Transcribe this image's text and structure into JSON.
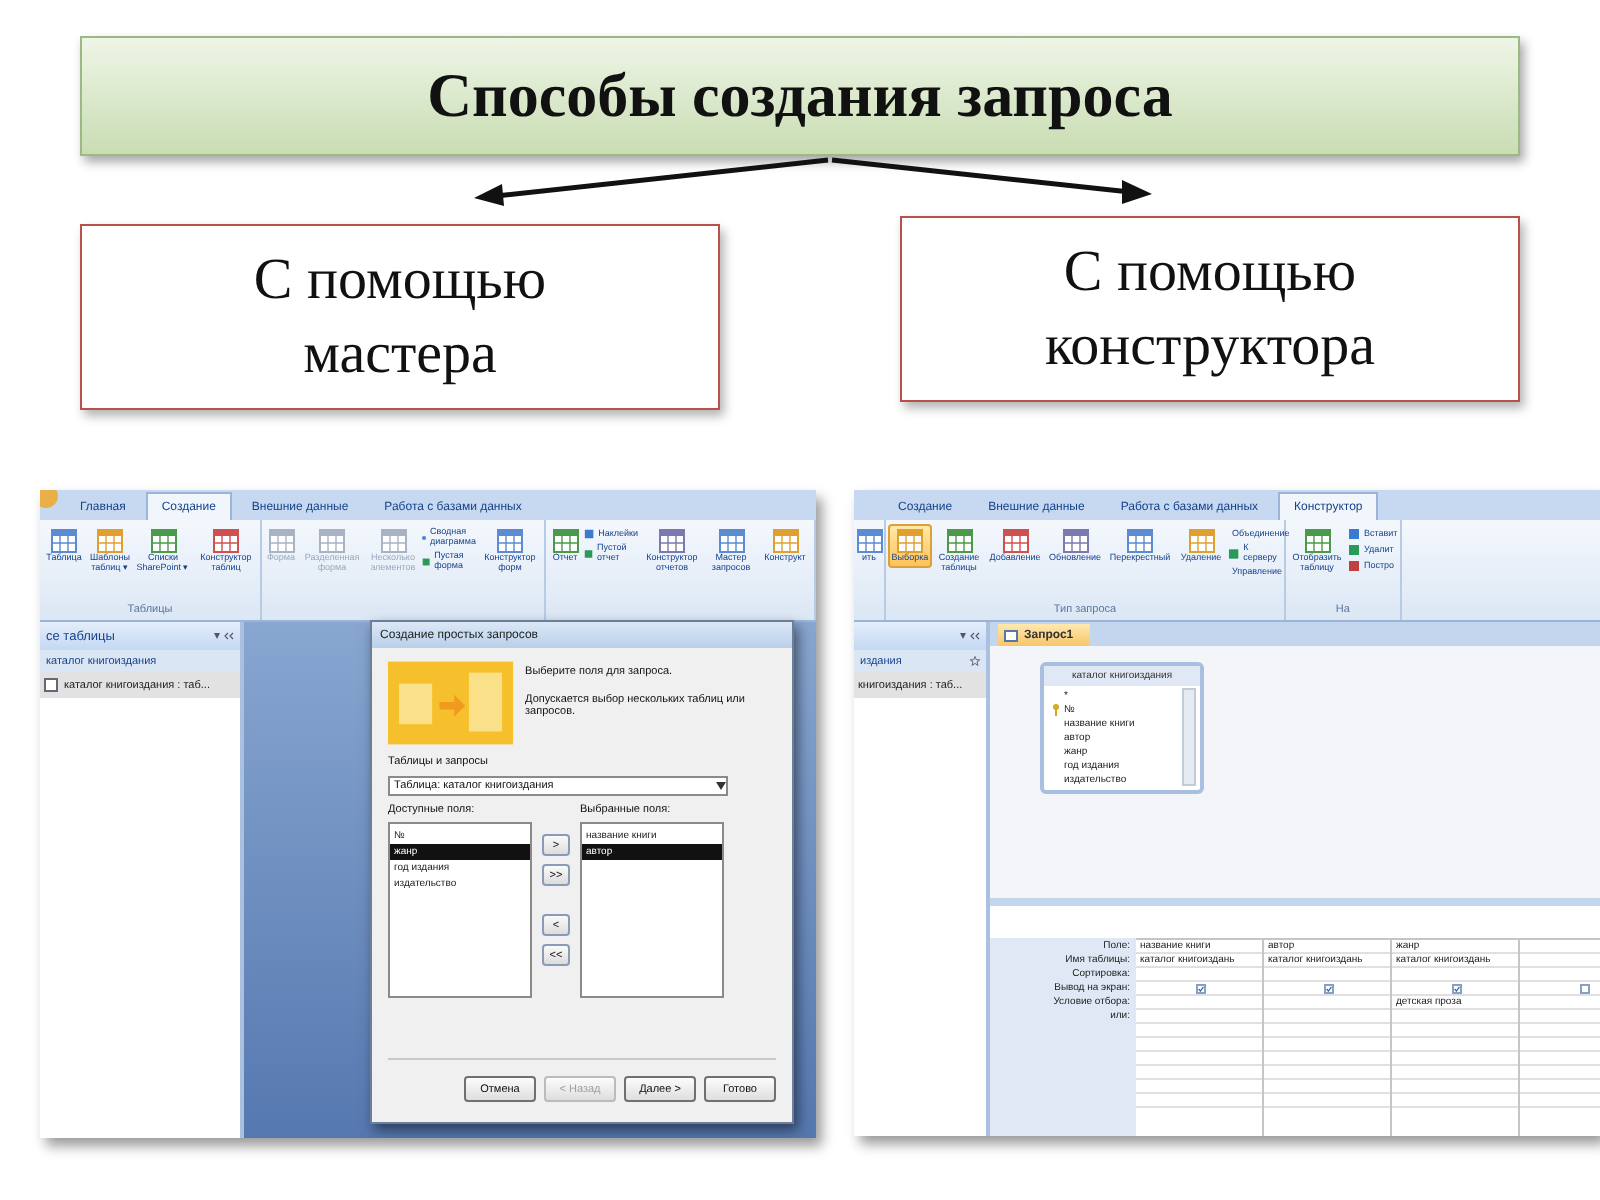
{
  "title": "Способы создания запроса",
  "methods": [
    {
      "label": "С помощью мастера"
    },
    {
      "label": "С помощью конструктора"
    }
  ],
  "wizard_screenshot": {
    "tabs": [
      {
        "label": "Главная",
        "selected": false
      },
      {
        "label": "Создание",
        "selected": true
      },
      {
        "label": "Внешние данные",
        "selected": false
      },
      {
        "label": "Работа с базами данных",
        "selected": false
      }
    ],
    "ribbon_groups": [
      {
        "label": "Таблицы",
        "items": [
          {
            "kind": "large",
            "label": "Таблица",
            "disabled": false
          },
          {
            "kind": "large",
            "label": "Шаблоны таблиц ▾",
            "disabled": false
          },
          {
            "kind": "large",
            "label": "Списки SharePoint ▾",
            "disabled": false
          },
          {
            "kind": "large",
            "label": "Конструктор таблиц",
            "disabled": false
          }
        ]
      },
      {
        "items": [
          {
            "kind": "large",
            "label": "Форма",
            "disabled": true
          },
          {
            "kind": "large",
            "label": "Разделенная форма",
            "disabled": true
          },
          {
            "kind": "large",
            "label": "Несколько элементов",
            "disabled": true
          },
          {
            "kind": "stack",
            "entries": [
              "Сводная диаграмма",
              "Пустая форма"
            ]
          },
          {
            "kind": "large",
            "label": "Конструктор форм",
            "disabled": false
          }
        ]
      },
      {
        "items": [
          {
            "kind": "large",
            "label": "Отчет",
            "disabled": false
          },
          {
            "kind": "stack",
            "entries": [
              "Наклейки",
              "Пустой отчет"
            ]
          },
          {
            "kind": "large",
            "label": "Конструктор отчетов",
            "disabled": false
          },
          {
            "kind": "large",
            "label": "Мастер запросов",
            "disabled": false
          },
          {
            "kind": "large",
            "label": "Конструкт",
            "disabled": false
          }
        ]
      }
    ],
    "nav": {
      "header": "се таблицы",
      "group": "каталог книгоиздания",
      "item": "каталог книгоиздания : таб..."
    },
    "dialog": {
      "title": "Создание простых запросов",
      "hint": "Выберите поля для запроса.",
      "note": "Допускается выбор нескольких таблиц или запросов.",
      "source_label": "Таблицы и запросы",
      "source_value": "Таблица: каталог книгоиздания",
      "available_label": "Доступные поля:",
      "available": [
        {
          "label": "№",
          "selected": false
        },
        {
          "label": "жанр",
          "selected": true
        },
        {
          "label": "год издания",
          "selected": false
        },
        {
          "label": "издательство",
          "selected": false
        }
      ],
      "chosen_label": "Выбранные поля:",
      "chosen": [
        {
          "label": "название книги",
          "selected": false
        },
        {
          "label": "автор",
          "selected": true
        }
      ],
      "move_buttons": [
        ">",
        ">>",
        "<",
        "<<"
      ],
      "buttons": [
        {
          "label": "Отмена",
          "disabled": false
        },
        {
          "label": "< Назад",
          "disabled": true
        },
        {
          "label": "Далее >",
          "disabled": false
        },
        {
          "label": "Готово",
          "disabled": false
        }
      ]
    }
  },
  "designer_screenshot": {
    "tabs": [
      {
        "label": "Создание",
        "selected": false
      },
      {
        "label": "Внешние данные",
        "selected": false
      },
      {
        "label": "Работа с базами данных",
        "selected": false
      },
      {
        "label": "Конструктор",
        "selected": true
      }
    ],
    "ribbon_groups": [
      {
        "items": [
          {
            "kind": "large",
            "label": "ить",
            "selected": false
          }
        ]
      },
      {
        "label": "Тип запроса",
        "items": [
          {
            "kind": "large",
            "label": "Выборка",
            "selected": true
          },
          {
            "kind": "large",
            "label": "Создание таблицы",
            "selected": false
          },
          {
            "kind": "large",
            "label": "Добавление",
            "selected": false
          },
          {
            "kind": "large",
            "label": "Обновление",
            "selected": false
          },
          {
            "kind": "large",
            "label": "Перекрестный",
            "selected": false
          },
          {
            "kind": "large",
            "label": "Удаление",
            "selected": false
          },
          {
            "kind": "stack",
            "entries": [
              "Объединение",
              "К серверу",
              "Управление"
            ]
          }
        ]
      },
      {
        "label": "На",
        "items": [
          {
            "kind": "large",
            "label": "Отобразить таблицу",
            "selected": false
          },
          {
            "kind": "stack",
            "entries": [
              "Вставит",
              "Удалит",
              "Постро"
            ]
          }
        ]
      }
    ],
    "nav": {
      "group": "издания",
      "item": "книгоиздания : таб..."
    },
    "document_tab": "Запрос1",
    "table": {
      "title": "каталог книгоиздания",
      "fields": [
        {
          "label": "*",
          "key": false
        },
        {
          "label": "№",
          "key": true
        },
        {
          "label": "название книги",
          "key": false
        },
        {
          "label": "автор",
          "key": false
        },
        {
          "label": "жанр",
          "key": false
        },
        {
          "label": "год издания",
          "key": false
        },
        {
          "label": "издательство",
          "key": false
        }
      ]
    },
    "grid": {
      "row_labels": [
        "Поле:",
        "Имя таблицы:",
        "Сортировка:",
        "Вывод на экран:",
        "Условие отбора:",
        "или:"
      ],
      "columns": [
        {
          "field": "название книги",
          "table": "каталог книгоиздань",
          "show": true
        },
        {
          "field": "автор",
          "table": "каталог книгоиздань",
          "show": true
        },
        {
          "field": "жанр",
          "table": "каталог книгоиздань",
          "show": true,
          "criteria": "детская проза"
        },
        {
          "show": false
        }
      ]
    }
  }
}
